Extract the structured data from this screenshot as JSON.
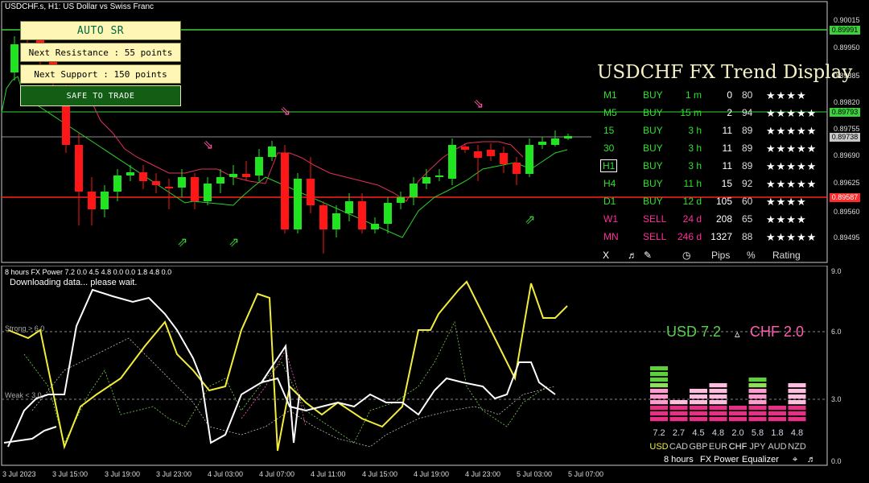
{
  "header": {
    "symbol_title": "USDCHF.s, H1:  US Dollar vs Swiss Franc"
  },
  "sr_panel": {
    "title": "AUTO SR",
    "next_resistance": "Next Resistance : 55 points",
    "next_support": "Next Support : 150 points",
    "safe_button": "SAFE TO TRADE"
  },
  "trend_display": {
    "title": "USDCHF FX Trend Display",
    "rows": [
      {
        "tf": "M1",
        "signal": "BUY",
        "dur": "1 m",
        "pips": "0",
        "pct": "80",
        "stars": "★★★★",
        "color": "#2ee02e"
      },
      {
        "tf": "M5",
        "signal": "BUY",
        "dur": "15 m",
        "pips": "2",
        "pct": "94",
        "stars": "★★★★★",
        "color": "#2ee02e"
      },
      {
        "tf": "15",
        "signal": "BUY",
        "dur": "3 h",
        "pips": "11",
        "pct": "89",
        "stars": "★★★★★",
        "color": "#2ee02e"
      },
      {
        "tf": "30",
        "signal": "BUY",
        "dur": "3 h",
        "pips": "11",
        "pct": "89",
        "stars": "★★★★★",
        "color": "#2ee02e"
      },
      {
        "tf": "H1",
        "signal": "BUY",
        "dur": "3 h",
        "pips": "11",
        "pct": "89",
        "stars": "★★★★★",
        "color": "#2ee02e"
      },
      {
        "tf": "H4",
        "signal": "BUY",
        "dur": "11 h",
        "pips": "15",
        "pct": "92",
        "stars": "★★★★★",
        "color": "#2ee02e"
      },
      {
        "tf": "D1",
        "signal": "BUY",
        "dur": "12 d",
        "pips": "105",
        "pct": "60",
        "stars": "★★★★",
        "color": "#2ee02e"
      },
      {
        "tf": "W1",
        "signal": "SELL",
        "dur": "24 d",
        "pips": "208",
        "pct": "65",
        "stars": "★★★★",
        "color": "#ff2e9a"
      },
      {
        "tf": "MN",
        "signal": "SELL",
        "dur": "246 d",
        "pips": "1327",
        "pct": "88",
        "stars": "★★★★★",
        "color": "#ff2e9a"
      }
    ],
    "footer": {
      "close": "X",
      "pips": "Pips",
      "pct": "%",
      "rating": "Rating"
    }
  },
  "price_axis": {
    "ticks": [
      "0.90015",
      "0.89950",
      "0.89885",
      "0.89820",
      "0.89755",
      "0.89690",
      "0.89625",
      "0.89560",
      "0.89495"
    ],
    "resistance_label": "0.89991",
    "mid_label": "0.89793",
    "current_label": "0.89738",
    "support_label": "0.89587"
  },
  "indicator": {
    "title": "8 hours FX Power 7.2 0.0 4.5 4.8 0.0 0.0 1.8 4.8 0.0",
    "status": "Downloading data... please wait.",
    "strong_label": "Strong > 6.0",
    "weak_label": "Weak < 3.0",
    "scale_ticks": [
      "9.0",
      "6.0",
      "3.0",
      "0.0"
    ],
    "pair_base": "USD 7.2",
    "pair_arrow": "▵",
    "pair_quote": "CHF 2.0",
    "equalizer": {
      "currencies": [
        "USD",
        "CAD",
        "GBP",
        "EUR",
        "CHF",
        "JPY",
        "AUD",
        "NZD"
      ],
      "values": [
        "7.2",
        "2.7",
        "4.5",
        "4.8",
        "2.0",
        "5.8",
        "1.8",
        "4.8"
      ],
      "levels": [
        7.2,
        2.7,
        4.5,
        4.8,
        2.0,
        5.8,
        1.8,
        4.8
      ]
    },
    "tools": {
      "period": "8 hours",
      "name": "FX Power",
      "mode": "Equalizer"
    }
  },
  "time_axis": {
    "ticks": [
      "3 Jul 2023",
      "3 Jul 15:00",
      "3 Jul 19:00",
      "3 Jul 23:00",
      "4 Jul 03:00",
      "4 Jul 07:00",
      "4 Jul 11:00",
      "4 Jul 15:00",
      "4 Jul 19:00",
      "4 Jul 23:00",
      "5 Jul 03:00",
      "5 Jul 07:00"
    ]
  },
  "colors": {
    "buy": "#2ee02e",
    "sell": "#ff2e9a",
    "resistance": "#3bd23b",
    "support": "#ff1f1f",
    "bull_candle": "#1fe41f",
    "bear_candle": "#ff1616"
  }
}
